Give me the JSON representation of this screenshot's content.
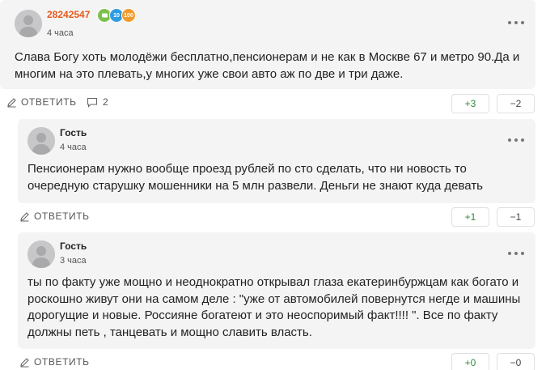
{
  "comments": [
    {
      "author": "28242547",
      "time": "4 часа",
      "text": "Слава Богу хоть молодёжи бесплатно,пенсионерам и не как в Москве 67 и метро 90.Да и многим на это плевать,у многих уже свои авто аж по две и три даже.",
      "reply_label": "ОТВЕТИТЬ",
      "replies_count": "2",
      "plus": "+3",
      "minus": "−2",
      "badges": [
        "",
        "10",
        "100"
      ]
    },
    {
      "author": "Гость",
      "time": "4 часа",
      "text": "Пенсионерам нужно вообще проезд рублей по сто сделать, что ни новость то очередную старушку мошенники на 5 млн развели. Деньги не знают куда девать",
      "reply_label": "ОТВЕТИТЬ",
      "plus": "+1",
      "minus": "−1"
    },
    {
      "author": "Гость",
      "time": "3 часа",
      "text": "ты по факту уже мощно и неоднократно открывал глаза екатеринбуржцам как богато и роскошно живут они на самом деле : \"уже от автомобилей повернутся негде и машины дорогущие и новые. Россияне богатеют и это неоспоримый факт!!!! \". Все по факту должны петь , танцевать и мощно славить власть.",
      "reply_label": "ОТВЕТИТЬ",
      "plus": "+0",
      "minus": "−0"
    }
  ],
  "colors": {
    "card_bg": "#f4f4f5",
    "author_highlight": "#e8591c",
    "plus": "#2e8b3a",
    "badge_green": "#7cc04a",
    "badge_blue": "#2f9be0",
    "badge_orange": "#f39a2b"
  },
  "icons": [
    "more-dots-icon",
    "pencil-icon",
    "comment-bubble-icon",
    "avatar-placeholder-icon"
  ]
}
